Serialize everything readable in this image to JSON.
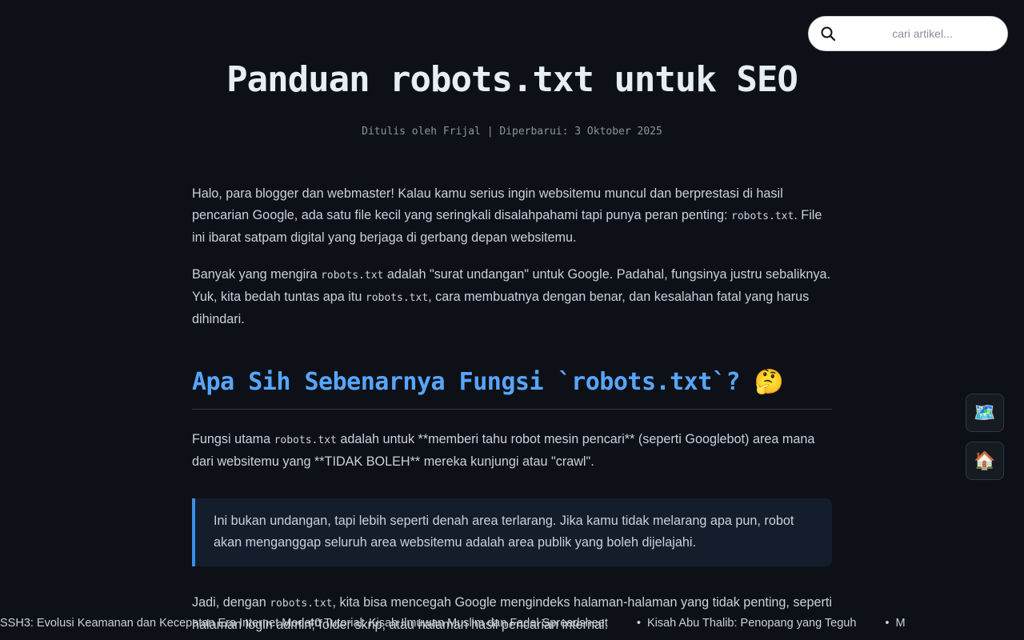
{
  "search": {
    "placeholder": "cari artikel..."
  },
  "article": {
    "title": "Panduan robots.txt untuk SEO",
    "meta": "Ditulis oleh Frijal | Diperbarui: 3 Oktober 2025",
    "p1": {
      "a": "Halo, para blogger dan webmaster! Kalau kamu serius ingin websitemu muncul dan berprestasi di hasil pencarian Google, ada satu file kecil yang seringkali disalahpahami tapi punya peran penting: ",
      "code": "robots.txt",
      "b": ". File ini ibarat satpam digital yang berjaga di gerbang depan websitemu."
    },
    "p2": {
      "a": "Banyak yang mengira ",
      "code1": "robots.txt",
      "b": " adalah \"surat undangan\" untuk Google. Padahal, fungsinya justru sebaliknya. Yuk, kita bedah tuntas apa itu ",
      "code2": "robots.txt",
      "c": ", cara membuatnya dengan benar, dan kesalahan fatal yang harus dihindari."
    },
    "h2": "Apa Sih Sebenarnya Fungsi `robots.txt`? 🤔",
    "p3": {
      "a": "Fungsi utama ",
      "code": "robots.txt",
      "b": " adalah untuk **memberi tahu robot mesin pencari** (seperti Googlebot) area mana dari websitemu yang **TIDAK BOLEH** mereka kunjungi atau \"crawl\"."
    },
    "quote": "Ini bukan undangan, tapi lebih seperti denah area terlarang. Jika kamu tidak melarang apa pun, robot akan menganggap seluruh area websitemu adalah area publik yang boleh dijelajahi.",
    "p4": {
      "a": "Jadi, dengan ",
      "code": "robots.txt",
      "b": ", kita bisa mencegah Google mengindeks halaman-halaman yang tidak penting, seperti halaman login admin, folder skrip, atau halaman hasil pencarian internal."
    }
  },
  "floating": {
    "map_icon": "🗺️",
    "home_icon": "🏠"
  },
  "ticker": {
    "back": [
      "SSH3: Evolusi Keamanan dan Kecepatan Era Internet Modern",
      "40 Tutorial: Kisah Ilmuwan Muslim dan Fadel Spreadsheet"
    ],
    "front": [
      "Kisah Abu Thalib: Penopang yang Teguh",
      "M"
    ]
  }
}
